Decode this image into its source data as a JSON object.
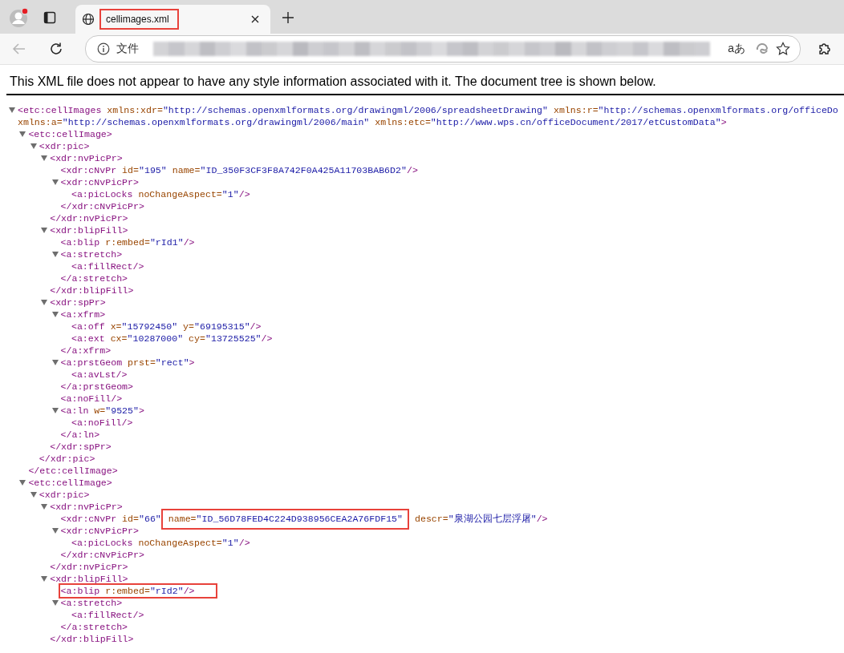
{
  "browser": {
    "tabs": [
      {
        "title": "cellimages.xml",
        "selected": true,
        "highlighted": true
      }
    ],
    "back": {
      "disabled": true
    },
    "address": {
      "scheme_label": "文件"
    },
    "translate_button": "aあ"
  },
  "message": "This XML file does not appear to have any style information associated with it. The document tree is shown below.",
  "tree": {
    "expanded": true,
    "open_rows": [
      [
        {
          "kind": "tag",
          "text": "<etc:cellImages"
        },
        {
          "kind": "attr",
          "text": " xmlns:xdr="
        },
        {
          "kind": "value",
          "text": "\"http://schemas.openxmlformats.org/drawingml/2006/spreadsheetDrawing\""
        },
        {
          "kind": "attr",
          "text": " xmlns:r="
        },
        {
          "kind": "value",
          "text": "\"http://schemas.openxmlformats.org/officeDo"
        }
      ],
      [
        {
          "kind": "attr",
          "text": "xmlns:a="
        },
        {
          "kind": "value",
          "text": "\"http://schemas.openxmlformats.org/drawingml/2006/main\""
        },
        {
          "kind": "attr",
          "text": " xmlns:etc="
        },
        {
          "kind": "value",
          "text": "\"http://www.wps.cn/officeDocument/2017/etCustomData\""
        },
        {
          "kind": "tag",
          "text": ">"
        }
      ]
    ],
    "children": [
      {
        "expanded": true,
        "open": [
          {
            "kind": "tag",
            "text": "<etc:cellImage>"
          }
        ],
        "close": "</etc:cellImage>",
        "children": [
          {
            "expanded": true,
            "open": [
              {
                "kind": "tag",
                "text": "<xdr:pic>"
              }
            ],
            "close": "</xdr:pic>",
            "children": [
              {
                "expanded": true,
                "open": [
                  {
                    "kind": "tag",
                    "text": "<xdr:nvPicPr>"
                  }
                ],
                "close": "</xdr:nvPicPr>",
                "children": [
                  {
                    "open": [
                      {
                        "kind": "tag",
                        "text": "<xdr:cNvPr"
                      },
                      {
                        "kind": "attr",
                        "text": " id="
                      },
                      {
                        "kind": "value",
                        "text": "\"195\""
                      },
                      {
                        "kind": "attr",
                        "text": " name="
                      },
                      {
                        "kind": "value",
                        "text": "\"ID_350F3CF3F8A742F0A425A11703BAB6D2\""
                      },
                      {
                        "kind": "tag",
                        "text": "/>"
                      }
                    ]
                  },
                  {
                    "expanded": true,
                    "open": [
                      {
                        "kind": "tag",
                        "text": "<xdr:cNvPicPr>"
                      }
                    ],
                    "close": "</xdr:cNvPicPr>",
                    "children": [
                      {
                        "open": [
                          {
                            "kind": "tag",
                            "text": "<a:picLocks"
                          },
                          {
                            "kind": "attr",
                            "text": " noChangeAspect="
                          },
                          {
                            "kind": "value",
                            "text": "\"1\""
                          },
                          {
                            "kind": "tag",
                            "text": "/>"
                          }
                        ]
                      }
                    ]
                  }
                ]
              },
              {
                "expanded": true,
                "open": [
                  {
                    "kind": "tag",
                    "text": "<xdr:blipFill>"
                  }
                ],
                "close": "</xdr:blipFill>",
                "children": [
                  {
                    "open": [
                      {
                        "kind": "tag",
                        "text": "<a:blip"
                      },
                      {
                        "kind": "attr",
                        "text": " r:embed="
                      },
                      {
                        "kind": "value",
                        "text": "\"rId1\""
                      },
                      {
                        "kind": "tag",
                        "text": "/>"
                      }
                    ]
                  },
                  {
                    "expanded": true,
                    "open": [
                      {
                        "kind": "tag",
                        "text": "<a:stretch>"
                      }
                    ],
                    "close": "</a:stretch>",
                    "children": [
                      {
                        "open": [
                          {
                            "kind": "tag",
                            "text": "<a:fillRect/>"
                          }
                        ]
                      }
                    ]
                  }
                ]
              },
              {
                "expanded": true,
                "open": [
                  {
                    "kind": "tag",
                    "text": "<xdr:spPr>"
                  }
                ],
                "close": "</xdr:spPr>",
                "children": [
                  {
                    "expanded": true,
                    "open": [
                      {
                        "kind": "tag",
                        "text": "<a:xfrm>"
                      }
                    ],
                    "close": "</a:xfrm>",
                    "children": [
                      {
                        "open": [
                          {
                            "kind": "tag",
                            "text": "<a:off"
                          },
                          {
                            "kind": "attr",
                            "text": " x="
                          },
                          {
                            "kind": "value",
                            "text": "\"15792450\""
                          },
                          {
                            "kind": "attr",
                            "text": " y="
                          },
                          {
                            "kind": "value",
                            "text": "\"69195315\""
                          },
                          {
                            "kind": "tag",
                            "text": "/>"
                          }
                        ]
                      },
                      {
                        "open": [
                          {
                            "kind": "tag",
                            "text": "<a:ext"
                          },
                          {
                            "kind": "attr",
                            "text": " cx="
                          },
                          {
                            "kind": "value",
                            "text": "\"10287000\""
                          },
                          {
                            "kind": "attr",
                            "text": " cy="
                          },
                          {
                            "kind": "value",
                            "text": "\"13725525\""
                          },
                          {
                            "kind": "tag",
                            "text": "/>"
                          }
                        ]
                      }
                    ]
                  },
                  {
                    "expanded": true,
                    "open": [
                      {
                        "kind": "tag",
                        "text": "<a:prstGeom"
                      },
                      {
                        "kind": "attr",
                        "text": " prst="
                      },
                      {
                        "kind": "value",
                        "text": "\"rect\""
                      },
                      {
                        "kind": "tag",
                        "text": ">"
                      }
                    ],
                    "close": "</a:prstGeom>",
                    "children": [
                      {
                        "open": [
                          {
                            "kind": "tag",
                            "text": "<a:avLst/>"
                          }
                        ]
                      }
                    ]
                  },
                  {
                    "open": [
                      {
                        "kind": "tag",
                        "text": "<a:noFill/>"
                      }
                    ]
                  },
                  {
                    "expanded": true,
                    "open": [
                      {
                        "kind": "tag",
                        "text": "<a:ln"
                      },
                      {
                        "kind": "attr",
                        "text": " w="
                      },
                      {
                        "kind": "value",
                        "text": "\"9525\""
                      },
                      {
                        "kind": "tag",
                        "text": ">"
                      }
                    ],
                    "close": "</a:ln>",
                    "children": [
                      {
                        "open": [
                          {
                            "kind": "tag",
                            "text": "<a:noFill/>"
                          }
                        ]
                      }
                    ]
                  }
                ]
              }
            ]
          }
        ]
      },
      {
        "expanded": true,
        "open": [
          {
            "kind": "tag",
            "text": "<etc:cellImage>"
          }
        ],
        "children": [
          {
            "expanded": true,
            "open": [
              {
                "kind": "tag",
                "text": "<xdr:pic>"
              }
            ],
            "children": [
              {
                "expanded": true,
                "open": [
                  {
                    "kind": "tag",
                    "text": "<xdr:nvPicPr>"
                  }
                ],
                "close": "</xdr:nvPicPr>",
                "children": [
                  {
                    "open": [
                      {
                        "kind": "tag",
                        "text": "<xdr:cNvPr"
                      },
                      {
                        "kind": "attr",
                        "text": " id="
                      },
                      {
                        "kind": "value",
                        "text": "\"66\""
                      },
                      {
                        "kind": "boxed",
                        "tokens": [
                          {
                            "kind": "attr",
                            "text": " name="
                          },
                          {
                            "kind": "value",
                            "text": "\"ID_56D78FED4C224D938956CEA2A76FDF15\""
                          }
                        ]
                      },
                      {
                        "kind": "attr",
                        "text": " descr="
                      },
                      {
                        "kind": "value",
                        "text": "\"泉湖公园七层浮屠\""
                      },
                      {
                        "kind": "tag",
                        "text": "/>"
                      }
                    ]
                  },
                  {
                    "expanded": true,
                    "open": [
                      {
                        "kind": "tag",
                        "text": "<xdr:cNvPicPr>"
                      }
                    ],
                    "close": "</xdr:cNvPicPr>",
                    "children": [
                      {
                        "open": [
                          {
                            "kind": "tag",
                            "text": "<a:picLocks"
                          },
                          {
                            "kind": "attr",
                            "text": " noChangeAspect="
                          },
                          {
                            "kind": "value",
                            "text": "\"1\""
                          },
                          {
                            "kind": "tag",
                            "text": "/>"
                          }
                        ]
                      }
                    ]
                  }
                ]
              },
              {
                "expanded": true,
                "open": [
                  {
                    "kind": "tag",
                    "text": "<xdr:blipFill>"
                  }
                ],
                "close": "</xdr:blipFill>",
                "children": [
                  {
                    "highlighted": true,
                    "open": [
                      {
                        "kind": "tag",
                        "text": "<a:blip"
                      },
                      {
                        "kind": "attr",
                        "text": " r:embed="
                      },
                      {
                        "kind": "value",
                        "text": "\"rId2\""
                      },
                      {
                        "kind": "tag",
                        "text": "/>"
                      }
                    ]
                  },
                  {
                    "expanded": true,
                    "open": [
                      {
                        "kind": "tag",
                        "text": "<a:stretch>"
                      }
                    ],
                    "close": "</a:stretch>",
                    "children": [
                      {
                        "open": [
                          {
                            "kind": "tag",
                            "text": "<a:fillRect/>"
                          }
                        ]
                      }
                    ]
                  }
                ]
              }
            ]
          }
        ]
      }
    ]
  }
}
